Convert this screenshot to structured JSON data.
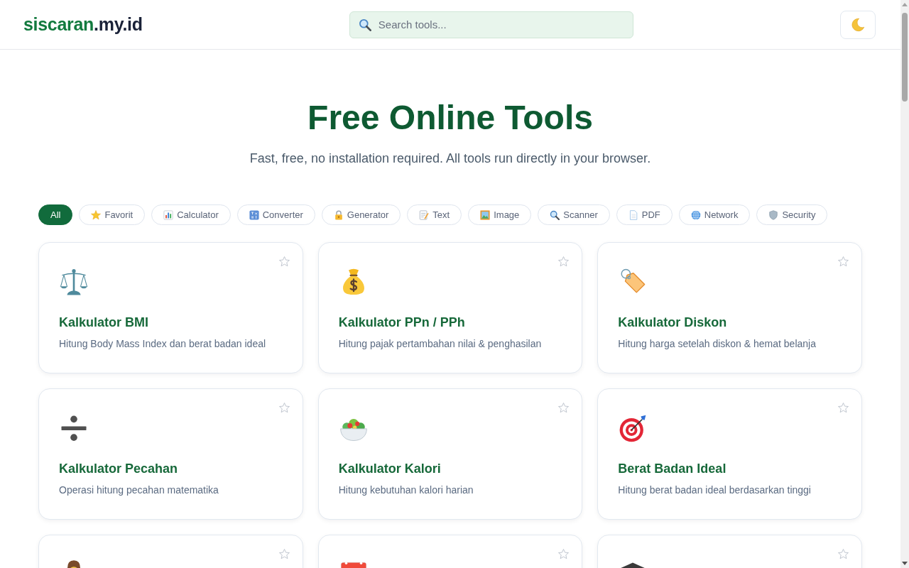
{
  "header": {
    "logo": {
      "name": "siscaran",
      "domain": ".my.id"
    },
    "search": {
      "placeholder": "Search tools..."
    }
  },
  "hero": {
    "title": "Free Online Tools",
    "subtitle": "Fast, free, no installation required. All tools run directly in your browser."
  },
  "filters": [
    {
      "label": "All",
      "selected": true
    },
    {
      "label": "Favorit",
      "selected": false
    },
    {
      "label": "Calculator",
      "selected": false
    },
    {
      "label": "Converter",
      "selected": false
    },
    {
      "label": "Generator",
      "selected": false
    },
    {
      "label": "Text",
      "selected": false
    },
    {
      "label": "Image",
      "selected": false
    },
    {
      "label": "Scanner",
      "selected": false
    },
    {
      "label": "PDF",
      "selected": false
    },
    {
      "label": "Network",
      "selected": false
    },
    {
      "label": "Security",
      "selected": false
    }
  ],
  "tools": [
    {
      "title": "Kalkulator BMI",
      "description": "Hitung Body Mass Index dan berat badan ideal",
      "favorite": false
    },
    {
      "title": "Kalkulator PPn / PPh",
      "description": "Hitung pajak pertambahan nilai & penghasilan",
      "favorite": false
    },
    {
      "title": "Kalkulator Diskon",
      "description": "Hitung harga setelah diskon & hemat belanja",
      "favorite": false
    },
    {
      "title": "Kalkulator Pecahan",
      "description": "Operasi hitung pecahan matematika",
      "favorite": false
    },
    {
      "title": "Kalkulator Kalori",
      "description": "Hitung kebutuhan kalori harian",
      "favorite": false
    },
    {
      "title": "Berat Badan Ideal",
      "description": "Hitung berat badan ideal berdasarkan tinggi",
      "favorite": false
    },
    {
      "favorite": false
    },
    {
      "favorite": false
    },
    {
      "favorite": false
    }
  ]
}
